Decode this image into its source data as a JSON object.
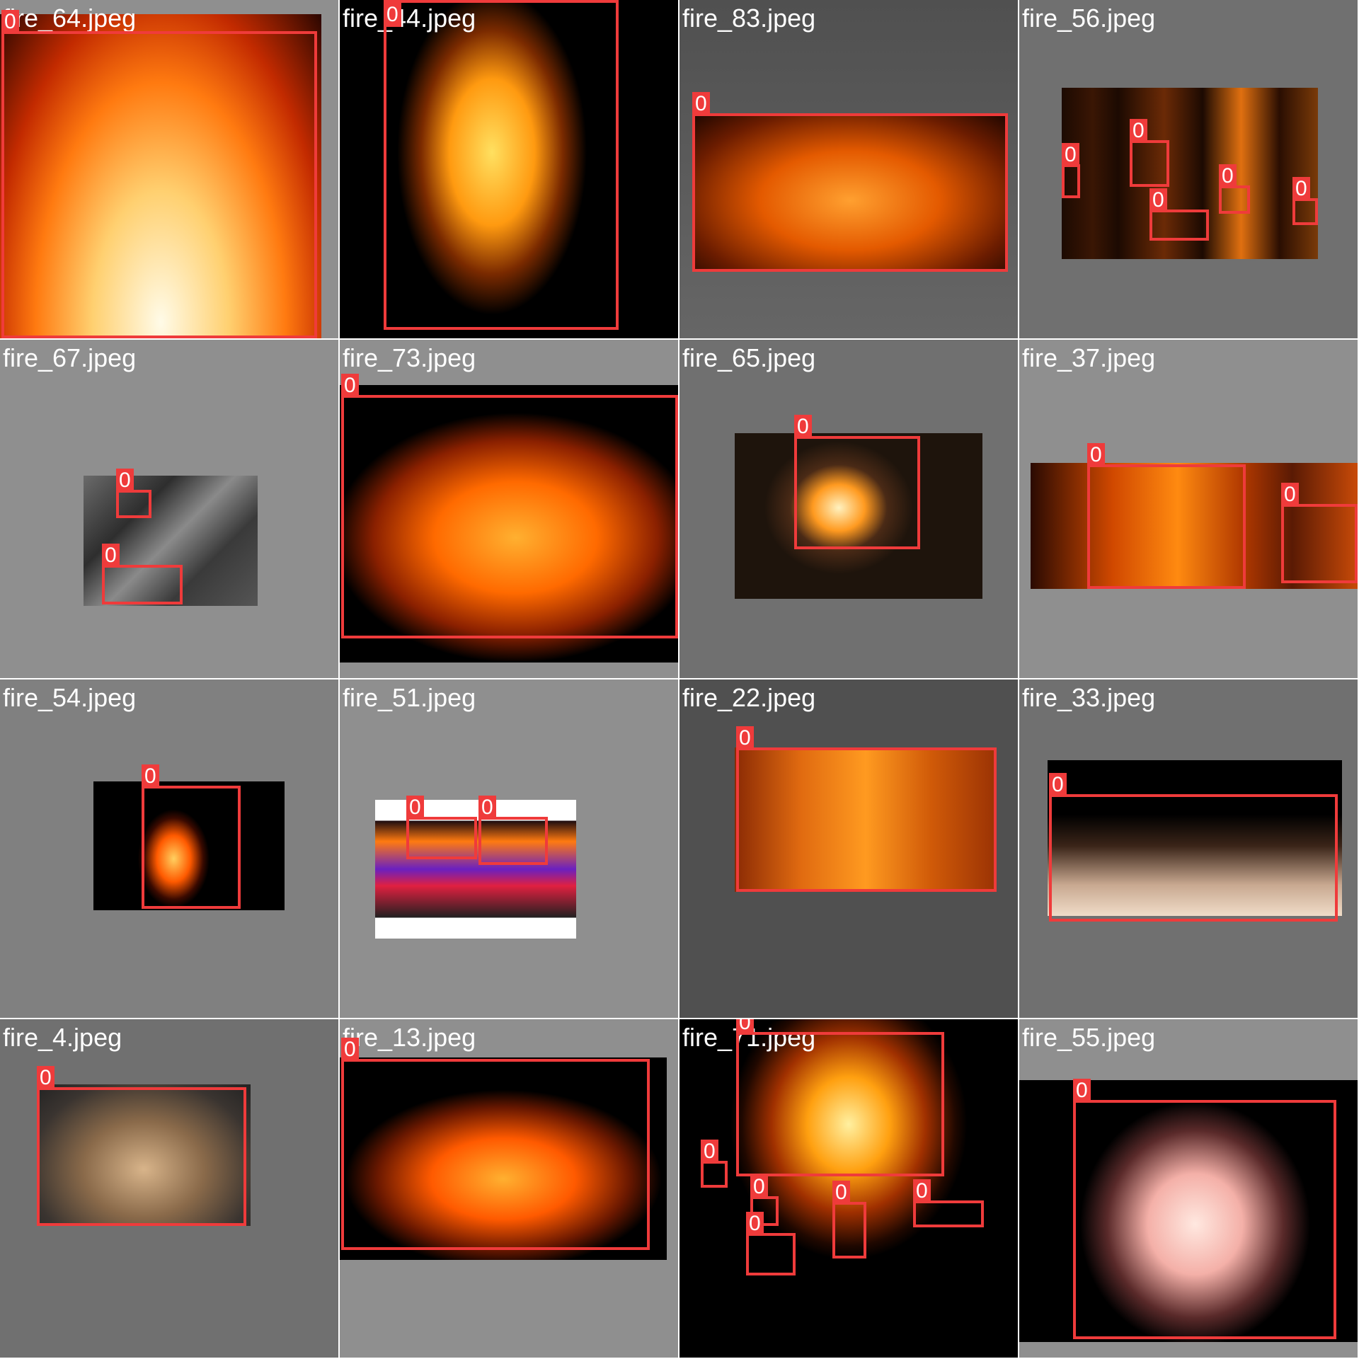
{
  "grid": {
    "tiles": [
      {
        "name": "fire_64.jpeg",
        "bg": "#8f8f8f",
        "labels": [
          "0"
        ]
      },
      {
        "name": "fire_44.jpeg",
        "bg": "#000000",
        "labels": [
          "0"
        ]
      },
      {
        "name": "fire_83.jpeg",
        "bg": "#505050",
        "labels": [
          "0"
        ]
      },
      {
        "name": "fire_56.jpeg",
        "bg": "#707070",
        "labels": [
          "0",
          "0",
          "0",
          "0",
          "0"
        ]
      },
      {
        "name": "fire_67.jpeg",
        "bg": "#8f8f8f",
        "labels": [
          "0",
          "0"
        ]
      },
      {
        "name": "fire_73.jpeg",
        "bg": "#8f8f8f",
        "labels": [
          "0"
        ]
      },
      {
        "name": "fire_65.jpeg",
        "bg": "#707070",
        "labels": [
          "0"
        ]
      },
      {
        "name": "fire_37.jpeg",
        "bg": "#8f8f8f",
        "labels": [
          "0",
          "0"
        ]
      },
      {
        "name": "fire_54.jpeg",
        "bg": "#808080",
        "labels": [
          "0"
        ]
      },
      {
        "name": "fire_51.jpeg",
        "bg": "#8f8f8f",
        "labels": [
          "0",
          "0"
        ]
      },
      {
        "name": "fire_22.jpeg",
        "bg": "#505050",
        "labels": [
          "0"
        ]
      },
      {
        "name": "fire_33.jpeg",
        "bg": "#707070",
        "labels": [
          "0"
        ]
      },
      {
        "name": "fire_4.jpeg",
        "bg": "#707070",
        "labels": [
          "0"
        ]
      },
      {
        "name": "fire_13.jpeg",
        "bg": "#8f8f8f",
        "labels": [
          "0"
        ]
      },
      {
        "name": "fire_71.jpeg",
        "bg": "#000000",
        "labels": [
          "0",
          "0",
          "0",
          "0",
          "0",
          "0"
        ]
      },
      {
        "name": "fire_55.jpeg",
        "bg": "#8f8f8f",
        "labels": [
          "0"
        ]
      }
    ]
  },
  "colors": {
    "box": "#ef3b3b",
    "label_text": "#ffffff",
    "grid_line": "#ffffff"
  }
}
